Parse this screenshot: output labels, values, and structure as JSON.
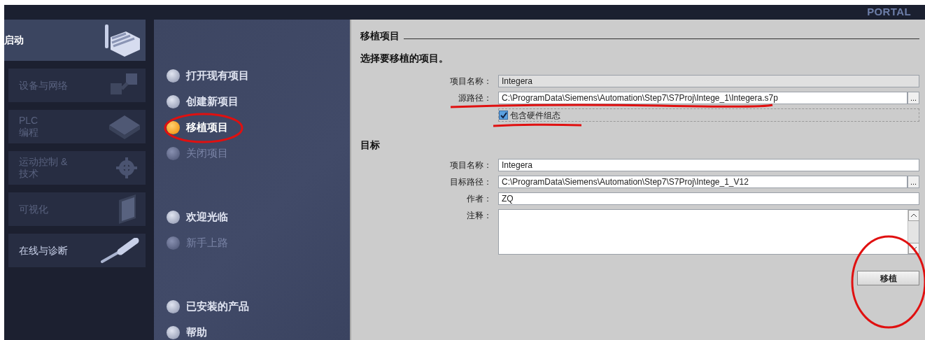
{
  "header": {
    "brand": "PORTAL"
  },
  "nav": [
    {
      "label": "启动",
      "selected": true,
      "disabled": false,
      "kind": "factory"
    },
    {
      "label": "设备与网络",
      "selected": false,
      "disabled": true,
      "kind": "devices"
    },
    {
      "label": "PLC\n编程",
      "selected": false,
      "disabled": true,
      "kind": "plc"
    },
    {
      "label": "运动控制 &\n技术",
      "selected": false,
      "disabled": true,
      "kind": "gear"
    },
    {
      "label": "可视化",
      "selected": false,
      "disabled": true,
      "kind": "screen"
    },
    {
      "label": "在线与诊断",
      "selected": false,
      "disabled": false,
      "kind": "tool"
    }
  ],
  "menu_groups": [
    [
      {
        "label": "打开现有项目",
        "selected": false,
        "disabled": false
      },
      {
        "label": "创建新项目",
        "selected": false,
        "disabled": false
      },
      {
        "label": "移植项目",
        "selected": true,
        "disabled": false
      },
      {
        "label": "关闭项目",
        "selected": false,
        "disabled": true
      }
    ],
    [
      {
        "label": "欢迎光临",
        "selected": false,
        "disabled": false
      },
      {
        "label": "新手上路",
        "selected": false,
        "disabled": true
      }
    ],
    [
      {
        "label": "已安装的产品",
        "selected": false,
        "disabled": false
      },
      {
        "label": "帮助",
        "selected": false,
        "disabled": false
      }
    ]
  ],
  "panel": {
    "title": "移植项目",
    "source": {
      "heading": "选择要移植的项目。",
      "fields": [
        {
          "label": "项目名称：",
          "value": "Integera",
          "kind": "readonly"
        },
        {
          "label": "源路径：",
          "value": "C:\\ProgramData\\Siemens\\Automation\\Step7\\S7Proj\\Intege_1\\Integera.s7p",
          "kind": "path",
          "browse": "..."
        }
      ],
      "checkbox": {
        "label": "包含硬件组态",
        "checked": true
      }
    },
    "target": {
      "heading": "目标",
      "fields": [
        {
          "label": "项目名称：",
          "value": "Integera",
          "kind": "text"
        },
        {
          "label": "目标路径：",
          "value": "C:\\ProgramData\\Siemens\\Automation\\Step7\\S7Proj\\Intege_1_V12",
          "kind": "path",
          "browse": "..."
        },
        {
          "label": "作者：",
          "value": "ZQ",
          "kind": "text"
        },
        {
          "label": "注释：",
          "kind": "textarea"
        }
      ]
    },
    "button": "移植"
  }
}
